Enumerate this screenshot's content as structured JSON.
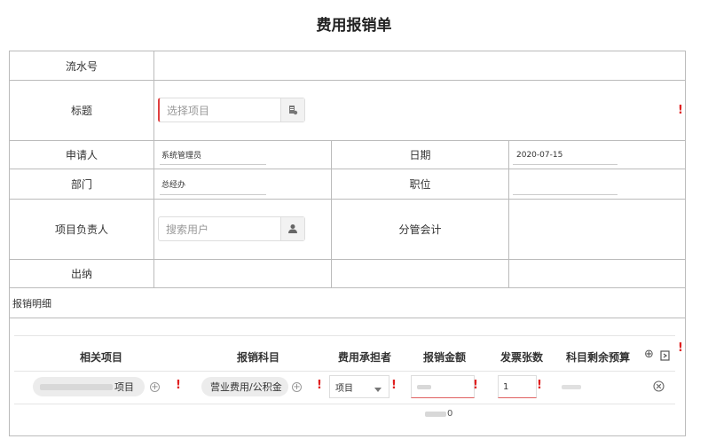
{
  "page_title": "费用报销单",
  "form": {
    "serial_label": "流水号",
    "title_label": "标题",
    "title_placeholder": "选择项目",
    "applicant_label": "申请人",
    "applicant_value": "系统管理员",
    "date_label": "日期",
    "date_value": "2020-07-15",
    "dept_label": "部门",
    "dept_value": "总经办",
    "position_label": "职位",
    "pm_label": "项目负责人",
    "pm_placeholder": "搜索用户",
    "accountant_label": "分管会计",
    "cashier_label": "出纳"
  },
  "detail": {
    "section_label": "报销明细",
    "columns": [
      "相关项目",
      "报销科目",
      "费用承担者",
      "报销金额",
      "发票张数",
      "科目剩余预算"
    ],
    "row": {
      "project_suffix": "项目",
      "subject": "营业费用/公积金",
      "bearer": "项目",
      "invoice_count": "1"
    },
    "total_suffix": "0"
  },
  "colors": {
    "required": "#e02020",
    "border": "#bbbbbb"
  },
  "icons": [
    "project-picker-icon",
    "user-icon",
    "add-row-icon",
    "import-icon",
    "remove-row-icon",
    "add-circle-icon",
    "dropdown-arrow-icon"
  ]
}
